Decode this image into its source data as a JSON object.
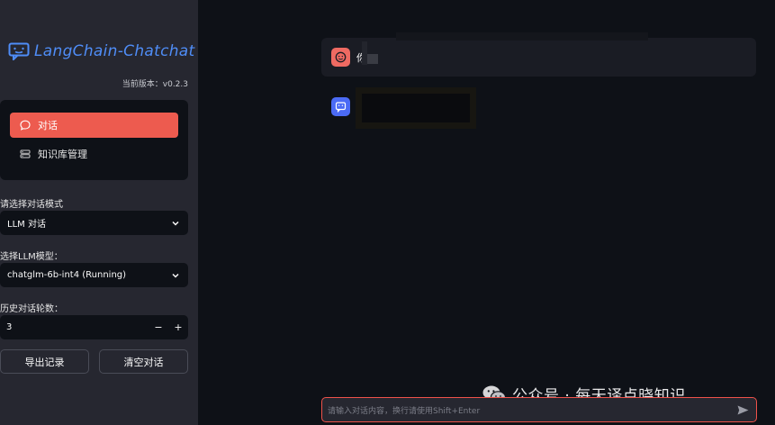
{
  "app": {
    "logo_text": "LangChain-Chatchat",
    "version": "当前版本：v0.2.3",
    "brand_color": "#4f8df7",
    "accent_color": "#ed5b4f"
  },
  "nav": {
    "items": [
      {
        "label": "对话",
        "icon": "chat-bubble-icon",
        "active": true
      },
      {
        "label": "知识库管理",
        "icon": "database-icon",
        "active": false
      }
    ]
  },
  "settings": {
    "mode_label": "请选择对话模式",
    "mode_value": "LLM 对话",
    "model_label": "选择LLM模型：",
    "model_value": "chatglm-6b-int4 (Running)",
    "history_label": "历史对话轮数：",
    "history_value": "3",
    "decrement": "−",
    "increment": "+"
  },
  "actions": {
    "export_label": "导出记录",
    "clear_label": "清空对话"
  },
  "chat": {
    "messages": [
      {
        "role": "user",
        "avatar_icon": "user-face-icon",
        "text": "你"
      },
      {
        "role": "assistant",
        "avatar_icon": "bot-icon",
        "text": ""
      }
    ],
    "input_placeholder": "请输入对话内容，换行请使用Shift+Enter"
  },
  "watermark": {
    "text": "公众号 · 每天译点晓知识",
    "icon": "wechat-icon"
  }
}
